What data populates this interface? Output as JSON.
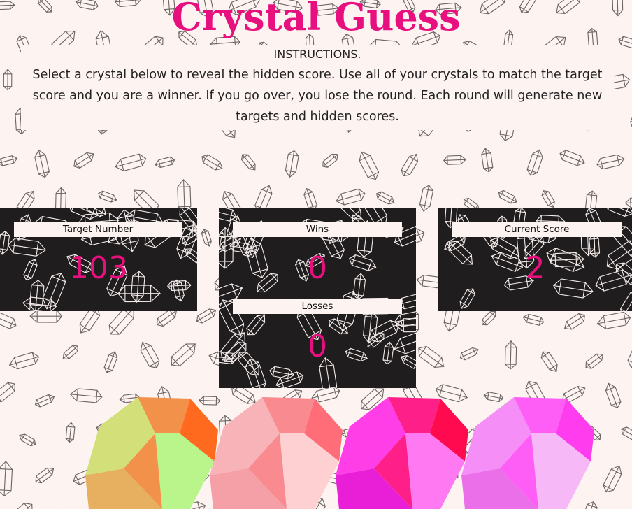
{
  "title": "Crystal Guess",
  "instructions": {
    "heading": "INSTRUCTIONS.",
    "body": "Select a crystal below to reveal the hidden score. Use all of your crystals to match the target score and you are a winner. If you go over, you lose the round. Each round will generate new targets and hidden scores."
  },
  "panels": {
    "target": {
      "label": "Target Number",
      "value": "103"
    },
    "wins": {
      "label": "Wins",
      "value": "0"
    },
    "losses": {
      "label": "Losses",
      "value": "0"
    },
    "current": {
      "label": "Current Score",
      "value": "2"
    }
  },
  "colors": {
    "accent": "#e8107f",
    "page_bg": "#fdf3f0",
    "panel_bg": "#1f1d1d"
  },
  "crystals": [
    {
      "name": "crystal-green-orange",
      "colors": [
        "#d3e07a",
        "#f2914a",
        "#ff6a1f",
        "#b9f58a",
        "#e6b060"
      ]
    },
    {
      "name": "crystal-pink",
      "colors": [
        "#f7b3b8",
        "#f98a90",
        "#ff6d78",
        "#ffd0d2",
        "#f5a0a6"
      ]
    },
    {
      "name": "crystal-magenta",
      "colors": [
        "#ff3ee8",
        "#ff1f88",
        "#ff0a4e",
        "#ff7af2",
        "#e81fd6"
      ]
    },
    {
      "name": "crystal-lilac",
      "colors": [
        "#f58ef7",
        "#ff5ef6",
        "#ff3cee",
        "#f7b8f8",
        "#ea6fe9"
      ]
    }
  ]
}
